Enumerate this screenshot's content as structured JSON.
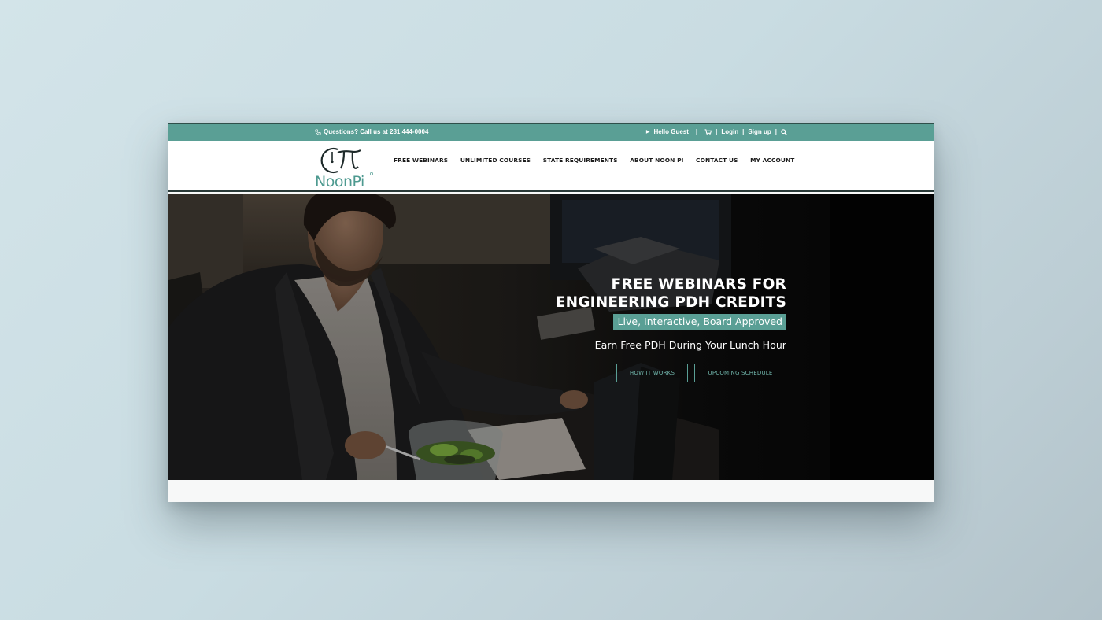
{
  "topbar": {
    "phone_text": "Questions? Call us at 281 444-0004",
    "greeting": "Hello Guest",
    "separator": "|",
    "login": "Login",
    "signup": "Sign up"
  },
  "logo": {
    "text": "NoonPi",
    "symbol": "π"
  },
  "nav": {
    "items": [
      "FREE WEBINARS",
      "UNLIMITED COURSES",
      "STATE REQUIREMENTS",
      "ABOUT NOON PI",
      "CONTACT US",
      "MY ACCOUNT"
    ]
  },
  "hero": {
    "title_line1": "FREE WEBINARS FOR",
    "title_line2": "ENGINEERING PDH CREDITS",
    "tagline": "Live, Interactive, Board Approved",
    "subtitle": "Earn Free PDH During Your Lunch Hour",
    "button_how": "HOW IT WORKS",
    "button_schedule": "UPCOMING SCHEDULE"
  },
  "colors": {
    "accent": "#5a9f95",
    "background": "#cfe0e5",
    "hero_bg": "#050505"
  },
  "icons": [
    "phone-icon",
    "caret-right-icon",
    "cart-icon",
    "search-icon"
  ]
}
